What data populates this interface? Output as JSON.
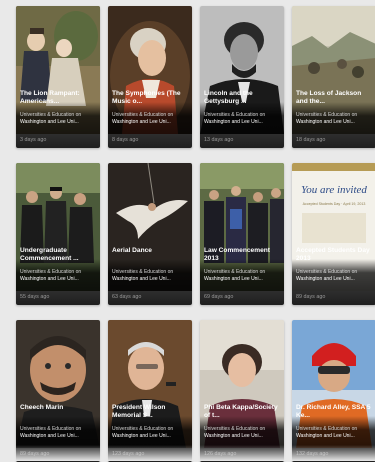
{
  "cards": [
    {
      "title": "The Lion Rampant: Americans...",
      "category": "Universities & Education on",
      "channel": "Washington and Lee Uni...",
      "age": "3 days ago",
      "image": "portrait-painting-couple"
    },
    {
      "title": "The Symphonies (The Music o...",
      "category": "Universities & Education on",
      "channel": "Washington and Lee Uni...",
      "age": "8 days ago",
      "image": "mozart-portrait"
    },
    {
      "title": "Lincoln and the Gettysburg ...",
      "category": "Universities & Education on",
      "channel": "Washington and Lee Uni...",
      "age": "13 days ago",
      "image": "lincoln-photo"
    },
    {
      "title": "The Loss of Jackson and the...",
      "category": "Universities & Education on",
      "channel": "Washington and Lee Uni...",
      "age": "18 days ago",
      "image": "battle-scene"
    },
    {
      "title": "Undergraduate Commencement ...",
      "category": "Universities & Education on",
      "channel": "Washington and Lee Uni...",
      "age": "55 days ago",
      "image": "graduates-crowd"
    },
    {
      "title": "Aerial Dance",
      "category": "Universities & Education on",
      "channel": "Washington and Lee Uni...",
      "age": "63 days ago",
      "image": "aerial-dancer"
    },
    {
      "title": "Law Commencement 2013",
      "category": "Universities & Education on",
      "channel": "Washington and Lee Uni...",
      "age": "69 days ago",
      "image": "law-graduates"
    },
    {
      "title": "Accepted Students Day 2013",
      "category": "Universities & Education on",
      "channel": "Washington and Lee Uni...",
      "age": "89 days ago",
      "image": "invitation-card"
    },
    {
      "title": "Cheech Marin",
      "category": "Universities & Education on",
      "channel": "Washington and Lee Uni...",
      "age": "89 days ago",
      "image": "cheech-portrait"
    },
    {
      "title": "President Wilson Memorial S...",
      "category": "Universities & Education on",
      "channel": "Washington and Lee Uni...",
      "age": "123 days ago",
      "image": "speaker-microphone"
    },
    {
      "title": "Phi Beta Kappa/Society of t...",
      "category": "Universities & Education on",
      "channel": "Washington and Lee Uni...",
      "age": "126 days ago",
      "image": "woman-portrait"
    },
    {
      "title": "Dr. Richard Alley, SSA 5 Ke...",
      "category": "Universities & Education on",
      "channel": "Washington and Lee Uni...",
      "age": "132 days ago",
      "image": "climber-helmet"
    }
  ],
  "invitation_text": "You are invited",
  "invitation_subtext": "Accepted Students Day · April 19, 2013"
}
